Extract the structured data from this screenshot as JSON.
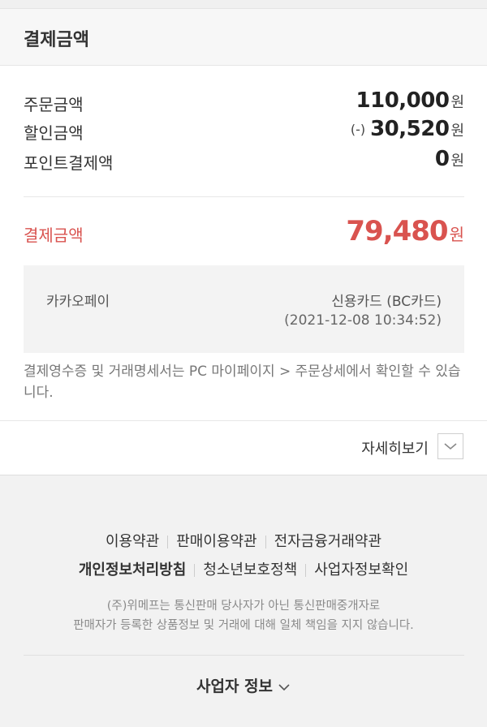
{
  "section": {
    "title": "결제금액"
  },
  "summary": {
    "order": {
      "label": "주문금액",
      "amount": "110,000",
      "unit": "원"
    },
    "discount": {
      "label": "할인금액",
      "prefix": "(-)",
      "amount": "30,520",
      "unit": "원"
    },
    "point": {
      "label": "포인트결제액",
      "amount": "0",
      "unit": "원"
    }
  },
  "total": {
    "label": "결제금액",
    "amount": "79,480",
    "unit": "원",
    "color": "#d9534f"
  },
  "payment": {
    "method": "카카오페이",
    "card": "신용카드 (BC카드)",
    "datetime": "(2021-12-08 10:34:52)"
  },
  "notice": "결제영수증 및 거래명세서는 PC 마이페이지 > 주문상세에서 확인할 수 있습니다.",
  "detail": {
    "label": "자세히보기",
    "icon": "chevron-down-icon"
  },
  "footer": {
    "links_row1": [
      "이용약관",
      "판매이용약관",
      "전자금융거래약관"
    ],
    "links_row2": [
      "개인정보처리방침",
      "청소년보호정책",
      "사업자정보확인"
    ],
    "disclaimer_line1": "(주)위메프는 통신판매 당사자가 아닌 통신판매중개자로",
    "disclaimer_line2": "판매자가 등록한 상품정보 및 거래에 대해 일체 책임을 지지 않습니다.",
    "biz_info_label": "사업자 정보",
    "biz_info_icon": "chevron-down-icon"
  }
}
